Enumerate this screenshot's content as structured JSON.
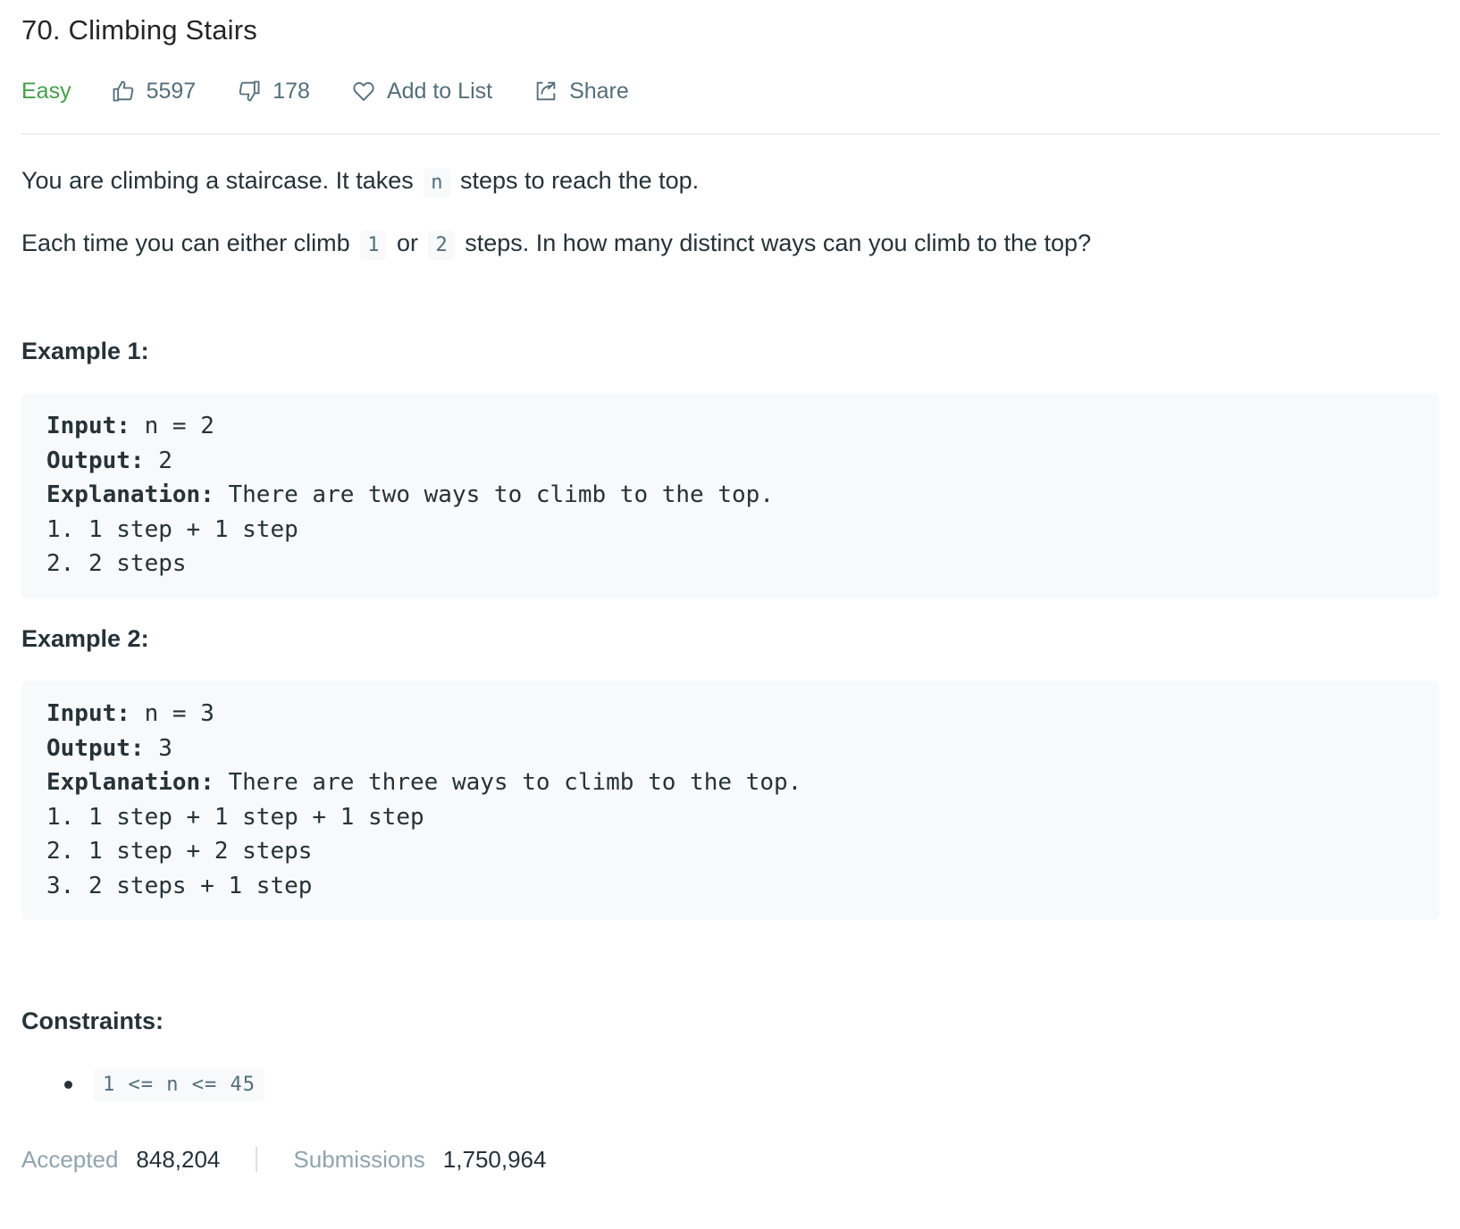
{
  "problem": {
    "title": "70. Climbing Stairs",
    "difficulty": "Easy",
    "likes": "5597",
    "dislikes": "178",
    "add_to_list": "Add to List",
    "share": "Share"
  },
  "description": {
    "p1_before": "You are climbing a staircase. It takes",
    "p1_code": "n",
    "p1_after": "steps to reach the top.",
    "p2_before": "Each time you can either climb",
    "p2_code1": "1",
    "p2_mid": "or",
    "p2_code2": "2",
    "p2_after": "steps. In how many distinct ways can you climb to the top?"
  },
  "examples": [
    {
      "title": "Example 1:",
      "input_label": "Input:",
      "input_value": " n = 2",
      "output_label": "Output:",
      "output_value": " 2",
      "explanation_label": "Explanation:",
      "explanation_value": " There are two ways to climb to the top.",
      "lines": [
        "1. 1 step + 1 step",
        "2. 2 steps"
      ]
    },
    {
      "title": "Example 2:",
      "input_label": "Input:",
      "input_value": " n = 3",
      "output_label": "Output:",
      "output_value": " 3",
      "explanation_label": "Explanation:",
      "explanation_value": " There are three ways to climb to the top.",
      "lines": [
        "1. 1 step + 1 step + 1 step",
        "2. 1 step + 2 steps",
        "3. 2 steps + 1 step"
      ]
    }
  ],
  "constraints": {
    "title": "Constraints:",
    "items": [
      "1 <= n <= 45"
    ]
  },
  "stats": {
    "accepted_label": "Accepted",
    "accepted_value": "848,204",
    "submissions_label": "Submissions",
    "submissions_value": "1,750,964"
  },
  "colors": {
    "difficulty_easy": "#43a047",
    "code_bg": "#f7f9fa",
    "muted": "#546e7a"
  },
  "icons": [
    "thumbs-up-icon",
    "thumbs-down-icon",
    "heart-icon",
    "share-icon"
  ]
}
